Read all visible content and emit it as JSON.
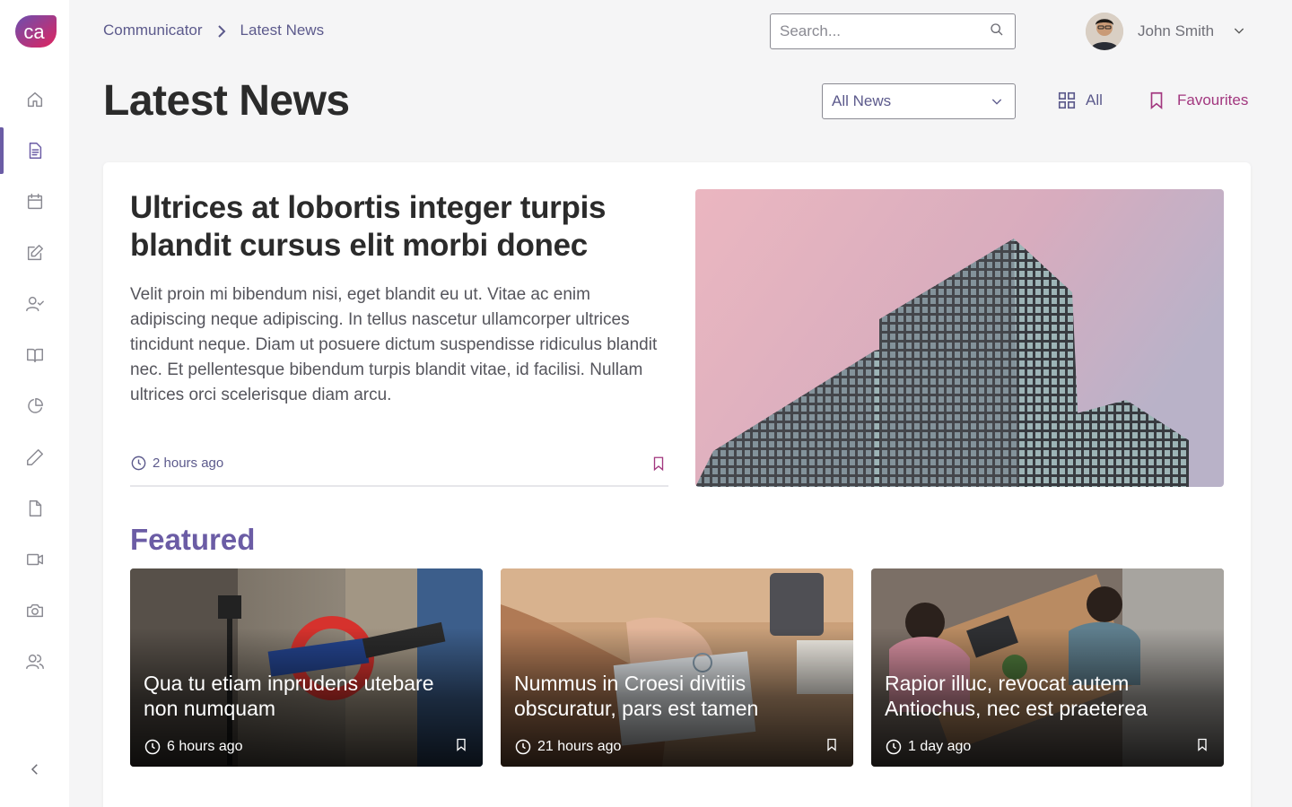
{
  "app": {
    "logo_text": "ca",
    "brand_color": "#6b5ca5",
    "accent_color": "#a2377f"
  },
  "breadcrumb": {
    "root": "Communicator",
    "current": "Latest News"
  },
  "search": {
    "placeholder": "Search...",
    "value": ""
  },
  "user": {
    "name": "John Smith"
  },
  "page": {
    "title": "Latest News"
  },
  "filters": {
    "category_selected": "All News",
    "view_all_label": "All",
    "favourites_label": "Favourites"
  },
  "sidebar": {
    "items": [
      {
        "icon": "home-icon"
      },
      {
        "icon": "document-icon",
        "active": true
      },
      {
        "icon": "calendar-icon"
      },
      {
        "icon": "edit-icon"
      },
      {
        "icon": "user-check-icon"
      },
      {
        "icon": "book-icon"
      },
      {
        "icon": "pie-chart-icon"
      },
      {
        "icon": "pencil-icon"
      },
      {
        "icon": "file-icon"
      },
      {
        "icon": "video-icon"
      },
      {
        "icon": "camera-icon"
      },
      {
        "icon": "users-icon"
      }
    ],
    "collapse_icon": "chevron-left-icon"
  },
  "hero": {
    "title": "Ultrices at lobortis integer turpis blandit cursus elit morbi donec",
    "body": "Velit proin mi bibendum nisi, eget blandit eu ut. Vitae ac enim adipiscing neque adipiscing. In tellus nascetur ullamcorper ultrices tincidunt neque. Diam ut posuere dictum suspendisse ridiculus blandit nec. Et pellentesque bibendum turpis blandit vitae, id facilisi. Nullam ultrices orci scelerisque diam arcu.",
    "time": "2 hours ago"
  },
  "featured": {
    "heading": "Featured",
    "items": [
      {
        "title": "Qua tu etiam inprudens utebare non numquam",
        "time": "6 hours ago"
      },
      {
        "title": "Nummus in Croesi divitiis obscuratur, pars est tamen",
        "time": "21 hours ago"
      },
      {
        "title": "Rapior illuc, revocat autem Antiochus, nec est praeterea",
        "time": "1 day ago"
      }
    ]
  }
}
